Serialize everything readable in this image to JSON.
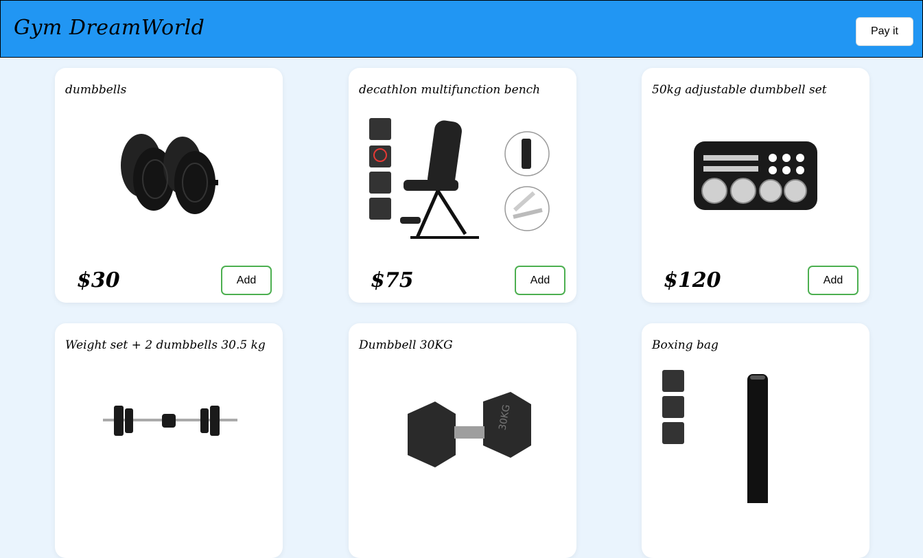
{
  "app": {
    "title": "Gym DreamWorld",
    "pay_label": "Pay it"
  },
  "products": [
    {
      "title": "dumbbells",
      "price": "$30",
      "add_label": "Add",
      "icon": "dumbbells-image"
    },
    {
      "title": "decathlon multifunction bench",
      "price": "$75",
      "add_label": "Add",
      "icon": "bench-image"
    },
    {
      "title": "50kg adjustable dumbbell set",
      "price": "$120",
      "add_label": "Add",
      "icon": "dumbbell-case-image"
    },
    {
      "title": "Weight set + 2 dumbbells 30.5 kg",
      "icon": "barbell-set-image"
    },
    {
      "title": "Dumbbell 30KG",
      "icon": "hex-dumbbell-image",
      "image_text": "30KG"
    },
    {
      "title": "Boxing bag",
      "icon": "boxing-bag-image"
    }
  ],
  "colors": {
    "header": "#2196f3",
    "background": "#eaf4fd",
    "add_border": "#4caf50"
  }
}
